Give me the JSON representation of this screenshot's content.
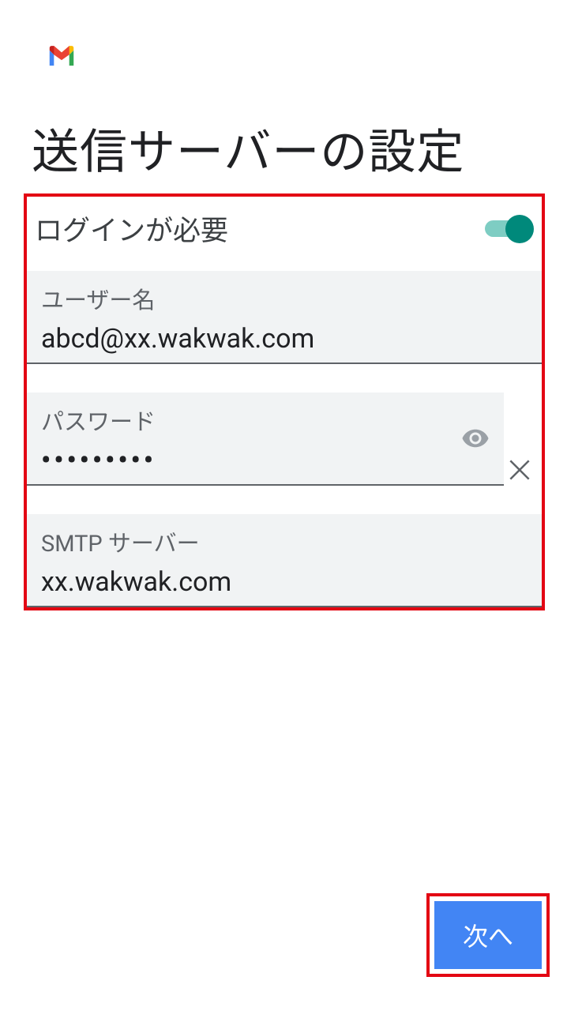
{
  "header": {
    "title": "送信サーバーの設定"
  },
  "form": {
    "login_required": {
      "label": "ログインが必要",
      "enabled": true
    },
    "username": {
      "label": "ユーザー名",
      "value": "abcd@xx.wakwak.com"
    },
    "password": {
      "label": "パスワード",
      "value": "•••••••••"
    },
    "smtp_server": {
      "label": "SMTP サーバー",
      "value": "xx.wakwak.com"
    }
  },
  "actions": {
    "next_label": "次へ"
  }
}
